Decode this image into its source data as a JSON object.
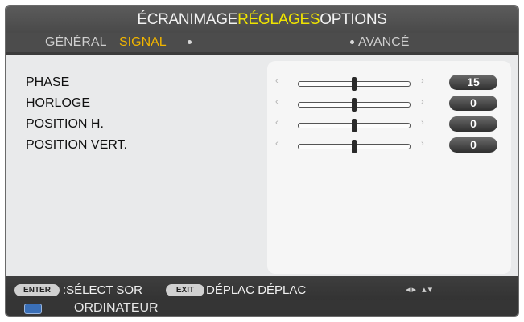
{
  "main_tabs": [
    {
      "label": "ÉCRANIMAGE",
      "active": false
    },
    {
      "label": "RÉGLAGES",
      "active": true
    },
    {
      "label": "OPTIONS",
      "active": false
    }
  ],
  "sub_tabs": [
    {
      "label": "GÉNÉRAL",
      "active": false
    },
    {
      "label": "SIGNAL",
      "active": true
    },
    {
      "label": "AVANCÉ",
      "active": false
    }
  ],
  "settings": [
    {
      "label": "PHASE",
      "value": "15",
      "level": 0.5
    },
    {
      "label": "HORLOGE",
      "value": "0",
      "level": 0.5
    },
    {
      "label": "POSITION H.",
      "value": "0",
      "level": 0.5
    },
    {
      "label": "POSITION VERT.",
      "value": "0",
      "level": 0.5
    }
  ],
  "arrows": {
    "left": "‹",
    "right": "›"
  },
  "footer": {
    "enter_key": "ENTER",
    "select_text": ":SÉLECT SOR",
    "exit_key": "EXIT",
    "move_text": "DÉPLAC DÉPLAC",
    "nav_icon": "◂▸ ▴▾",
    "source": "ORDINATEUR"
  },
  "colors": {
    "active_tab": "#f0e400",
    "active_subtab": "#f0b400",
    "source_icon": "#3a6fb7"
  }
}
